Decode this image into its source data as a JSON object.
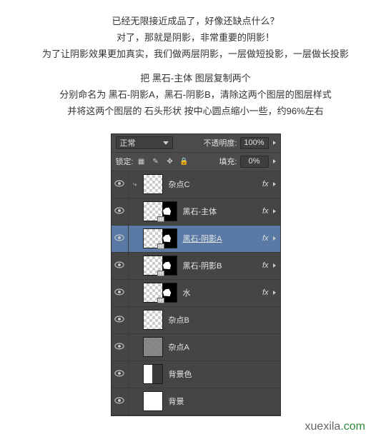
{
  "intro": {
    "l1": "已经无限接近成品了，好像还缺点什么？",
    "l2": "对了，那就是阴影，非常重要的阴影！",
    "l3": "为了让阴影效果更加真实，我们做两层阴影，一层做短投影，一层做长投影",
    "l4": "把 黑石-主体 图层复制两个",
    "l5": "分别命名为 黑石-阴影A，黑石-阴影B，清除这两个图层的图层样式",
    "l6": "并将这两个图层的 石头形状 按中心圆点缩小一些，约96%左右"
  },
  "panel": {
    "blend_mode": "正常",
    "opacity_label": "不透明度:",
    "opacity_value": "100%",
    "lock_label": "锁定:",
    "fill_label": "填充:",
    "fill_value": "0%"
  },
  "layers": [
    {
      "name": "杂点C",
      "fx": true,
      "thumb": "checker",
      "mask": false,
      "clipped": true
    },
    {
      "name": "黑石-主体",
      "fx": true,
      "thumb": "checker",
      "mask": true,
      "clipped": false
    },
    {
      "name": "黑石-阴影A",
      "fx": true,
      "thumb": "checker",
      "mask": true,
      "clipped": false,
      "selected": true
    },
    {
      "name": "黑石-阴影B",
      "fx": true,
      "thumb": "checker",
      "mask": true,
      "clipped": false
    },
    {
      "name": "水",
      "fx": true,
      "thumb": "checker",
      "mask": true,
      "clipped": false
    },
    {
      "name": "杂点B",
      "fx": false,
      "thumb": "checker",
      "mask": false,
      "clipped": false
    },
    {
      "name": "杂点A",
      "fx": false,
      "thumb": "noise",
      "mask": false,
      "clipped": false
    },
    {
      "name": "背景色",
      "fx": false,
      "thumb": "bgcolor",
      "mask": false,
      "clipped": false
    },
    {
      "name": "背景",
      "fx": false,
      "thumb": "plain",
      "mask": false,
      "clipped": false
    }
  ],
  "fx_text": "fx",
  "watermark": {
    "a": "xuexila",
    "b": ".com"
  }
}
